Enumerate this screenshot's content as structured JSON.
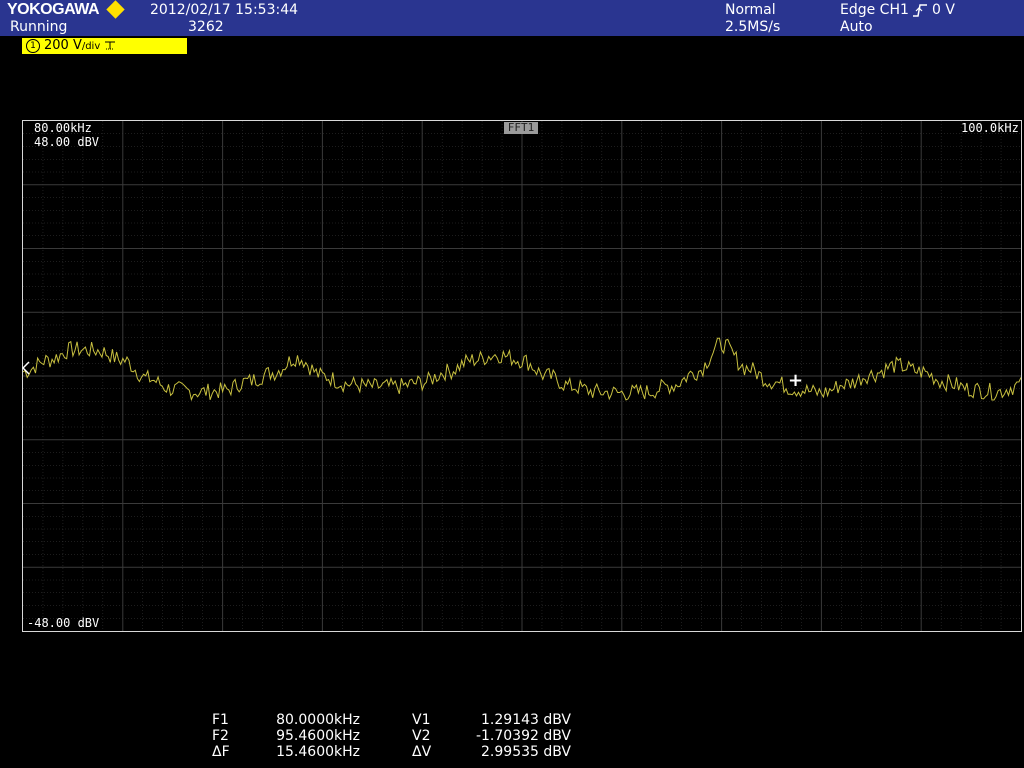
{
  "header": {
    "brand": "YOKOGAWA",
    "status": "Running",
    "datetime": "2012/02/17 15:53:44",
    "acq_count": "3262",
    "acq_mode": "Normal",
    "sample_rate": "2.5MS/s",
    "trigger": "Edge CH1",
    "trigger_level": "0 V",
    "trigger_mode": "Auto"
  },
  "channel": {
    "number": "1",
    "scale": "200 V",
    "unit": "/div"
  },
  "screen": {
    "freq_start": "80.00kHz",
    "freq_end": "100.0kHz",
    "v_top": "48.00 dBV",
    "v_bottom": "-48.00 dBV",
    "trace_label": "FFT1",
    "trace_color": "#c8c040",
    "grid_color": "#3a3a3a"
  },
  "chart_data": {
    "type": "line",
    "xlabel": "",
    "ylabel": "",
    "xlim": [
      80,
      100
    ],
    "ylim": [
      -48,
      48
    ],
    "series": [
      {
        "x": [
          80.0,
          80.5,
          81.0,
          81.5,
          82.0,
          82.5,
          83.0,
          83.5,
          84.0,
          84.5,
          85.0,
          85.5,
          86.0,
          86.5,
          87.0,
          87.5,
          88.0,
          88.5,
          89.0,
          89.5,
          90.0,
          90.5,
          91.0,
          91.5,
          92.0,
          92.5,
          93.0,
          93.5,
          94.0,
          94.5,
          95.0,
          95.5,
          96.0,
          96.5,
          97.0,
          97.5,
          98.0,
          98.5,
          99.0,
          99.5,
          100.0
        ],
        "y": [
          0.8,
          3.0,
          5.0,
          4.8,
          3.0,
          -0.5,
          -2.5,
          -3.0,
          -2.8,
          -1.0,
          0.6,
          3.5,
          0.0,
          -1.5,
          -2.0,
          -2.0,
          -1.2,
          0.8,
          3.0,
          4.0,
          3.0,
          0.0,
          -2.0,
          -3.0,
          -3.2,
          -3.0,
          -1.8,
          0.8,
          6.0,
          1.5,
          -1.0,
          -2.5,
          -3.2,
          -1.5,
          0.3,
          2.0,
          0.8,
          -1.2,
          -2.5,
          -3.0,
          -1.7
        ]
      }
    ]
  },
  "cursor": {
    "marker": "+",
    "freq": 95.46,
    "value": -1.70392
  },
  "measurements": {
    "f1_label": "F1",
    "f1_value": "80.0000kHz",
    "f2_label": "F2",
    "f2_value": "95.4600kHz",
    "df_label": "ΔF",
    "df_value": "15.4600kHz",
    "v1_label": "V1",
    "v1_value": "1.29143 dBV",
    "v2_label": "V2",
    "v2_value": "-1.70392 dBV",
    "dv_label": "ΔV",
    "dv_value": "2.99535 dBV"
  }
}
